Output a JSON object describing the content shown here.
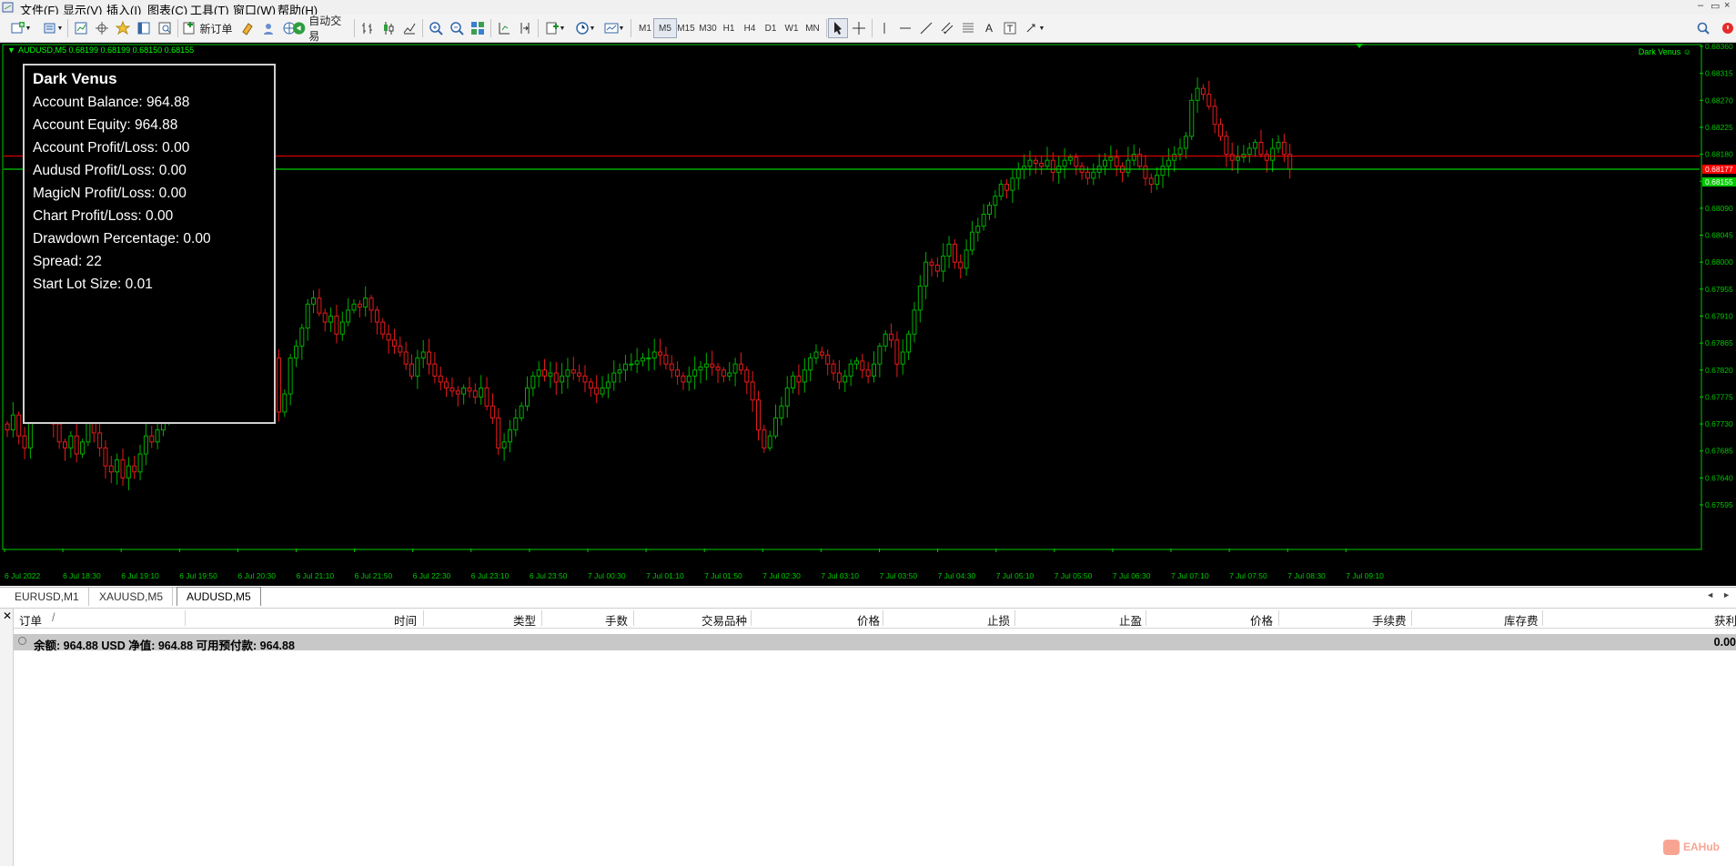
{
  "menu": {
    "items": [
      "文件(F)",
      "显示(V)",
      "插入(I)",
      "图表(C)",
      "工具(T)",
      "窗口(W)",
      "帮助(H)"
    ]
  },
  "toolbar": {
    "new_order_label": "新订单",
    "auto_trading_label": "自动交易",
    "timeframes": [
      "M1",
      "M5",
      "M15",
      "M30",
      "H1",
      "H4",
      "D1",
      "W1",
      "MN"
    ],
    "active_timeframe": "M5",
    "text_tool_label": "A"
  },
  "chart": {
    "header": "AUDUSD,M5  0.68199 0.68199 0.68150 0.68155",
    "ea_label": "Dark Venus ☺",
    "bid_label": "0.68177",
    "ask_label": "0.68155",
    "colors": {
      "bull": "#00b000",
      "bear": "#e51b1b",
      "axis": "#00c800",
      "bid_line": "#ff0000",
      "ask_line": "#00ff00"
    }
  },
  "chart_data": {
    "type": "candlestick",
    "symbol": "AUDUSD",
    "timeframe": "M5",
    "ylim": [
      0.67595,
      0.6836
    ],
    "y_ticks": [
      "0.68360",
      "0.68315",
      "0.68270",
      "0.68225",
      "0.68180",
      "0.68135",
      "0.68090",
      "0.68045",
      "0.68000",
      "0.67955",
      "0.67910",
      "0.67865",
      "0.67820",
      "0.67775",
      "0.67730",
      "0.67685",
      "0.67640",
      "0.67595"
    ],
    "x_ticks": [
      "6 Jul 2022",
      "6 Jul 18:30",
      "6 Jul 19:10",
      "6 Jul 19:50",
      "6 Jul 20:30",
      "6 Jul 21:10",
      "6 Jul 21:50",
      "6 Jul 22:30",
      "6 Jul 23:10",
      "6 Jul 23:50",
      "7 Jul 00:30",
      "7 Jul 01:10",
      "7 Jul 01:50",
      "7 Jul 02:30",
      "7 Jul 03:10",
      "7 Jul 03:50",
      "7 Jul 04:30",
      "7 Jul 05:10",
      "7 Jul 05:50",
      "7 Jul 06:30",
      "7 Jul 07:10",
      "7 Jul 07:50",
      "7 Jul 08:30",
      "7 Jul 09:10"
    ],
    "bid": 0.68177,
    "ask": 0.68155,
    "close": [
      0.6772,
      0.67745,
      0.6771,
      0.6769,
      0.6774,
      0.678,
      0.6778,
      0.6776,
      0.6773,
      0.677,
      0.6769,
      0.6771,
      0.6768,
      0.677,
      0.67735,
      0.67715,
      0.6769,
      0.6766,
      0.6765,
      0.6767,
      0.6764,
      0.6766,
      0.6765,
      0.6768,
      0.6771,
      0.677,
      0.6772,
      0.6775,
      0.678,
      0.6783,
      0.6786,
      0.6788,
      0.67895,
      0.6787,
      0.6786,
      0.6788,
      0.6789,
      0.67875,
      0.6788,
      0.6786,
      0.6787,
      0.679,
      0.67895,
      0.67875,
      0.6785,
      0.6789,
      0.6784,
      0.6775,
      0.6778,
      0.6784,
      0.6786,
      0.6789,
      0.6793,
      0.6794,
      0.67915,
      0.679,
      0.6791,
      0.6788,
      0.679,
      0.6792,
      0.6793,
      0.67925,
      0.6794,
      0.6792,
      0.679,
      0.6788,
      0.6787,
      0.6786,
      0.6785,
      0.6783,
      0.6781,
      0.6784,
      0.6785,
      0.6783,
      0.6781,
      0.678,
      0.6779,
      0.67785,
      0.6778,
      0.6779,
      0.67785,
      0.67775,
      0.6779,
      0.6776,
      0.6774,
      0.6769,
      0.677,
      0.6772,
      0.6774,
      0.6776,
      0.6779,
      0.6781,
      0.6782,
      0.6781,
      0.67815,
      0.678,
      0.6781,
      0.6782,
      0.67815,
      0.6781,
      0.678,
      0.6779,
      0.6778,
      0.6779,
      0.678,
      0.67815,
      0.6782,
      0.6783,
      0.6783,
      0.67835,
      0.6784,
      0.6784,
      0.6785,
      0.67845,
      0.6783,
      0.6782,
      0.6781,
      0.678,
      0.6781,
      0.6782,
      0.67825,
      0.6783,
      0.67825,
      0.6782,
      0.6781,
      0.67815,
      0.6783,
      0.6782,
      0.678,
      0.6777,
      0.6772,
      0.6769,
      0.6771,
      0.6774,
      0.6776,
      0.6779,
      0.6781,
      0.678,
      0.6782,
      0.6784,
      0.6785,
      0.67845,
      0.6783,
      0.67815,
      0.678,
      0.6781,
      0.6783,
      0.67835,
      0.6782,
      0.6781,
      0.6783,
      0.6786,
      0.6788,
      0.6787,
      0.6783,
      0.6785,
      0.6788,
      0.6792,
      0.6796,
      0.68,
      0.67995,
      0.67985,
      0.6801,
      0.6803,
      0.68,
      0.6799,
      0.6802,
      0.6805,
      0.6806,
      0.6808,
      0.68095,
      0.6811,
      0.6813,
      0.6812,
      0.6814,
      0.68155,
      0.6816,
      0.6817,
      0.68165,
      0.6816,
      0.6817,
      0.6815,
      0.6816,
      0.6817,
      0.68175,
      0.6816,
      0.6815,
      0.6814,
      0.6815,
      0.6816,
      0.6817,
      0.68175,
      0.6816,
      0.6815,
      0.6817,
      0.6818,
      0.6816,
      0.6814,
      0.6813,
      0.68145,
      0.6816,
      0.6817,
      0.6818,
      0.6819,
      0.6821,
      0.6827,
      0.6829,
      0.6828,
      0.6826,
      0.6823,
      0.6821,
      0.6818,
      0.6817,
      0.68175,
      0.6818,
      0.6819,
      0.682,
      0.6818,
      0.6817,
      0.6819,
      0.682,
      0.6818,
      0.68155
    ]
  },
  "info_panel": {
    "title": "Dark Venus",
    "rows": [
      "Account Balance: 964.88",
      "Account Equity: 964.88",
      "Account Profit/Loss: 0.00",
      "Audusd Profit/Loss: 0.00",
      "MagicN Profit/Loss: 0.00",
      "Chart Profit/Loss: 0.00",
      "Drawdown Percentage: 0.00",
      "Spread: 22",
      "Start Lot Size: 0.01"
    ]
  },
  "tabs": [
    "EURUSD,M1",
    "XAUUSD,M5",
    "AUDUSD,M5"
  ],
  "active_tab": "AUDUSD,M5",
  "terminal": {
    "columns": [
      "订单",
      "/",
      "时间",
      "类型",
      "手数",
      "交易品种",
      "价格",
      "止损",
      "止盈",
      "价格",
      "手续费",
      "库存费",
      "获利"
    ],
    "summary": "余额: 964.88 USD  净值: 964.88  可用预付款: 964.88",
    "summary_value": "0.00"
  },
  "watermark": "EAHub"
}
